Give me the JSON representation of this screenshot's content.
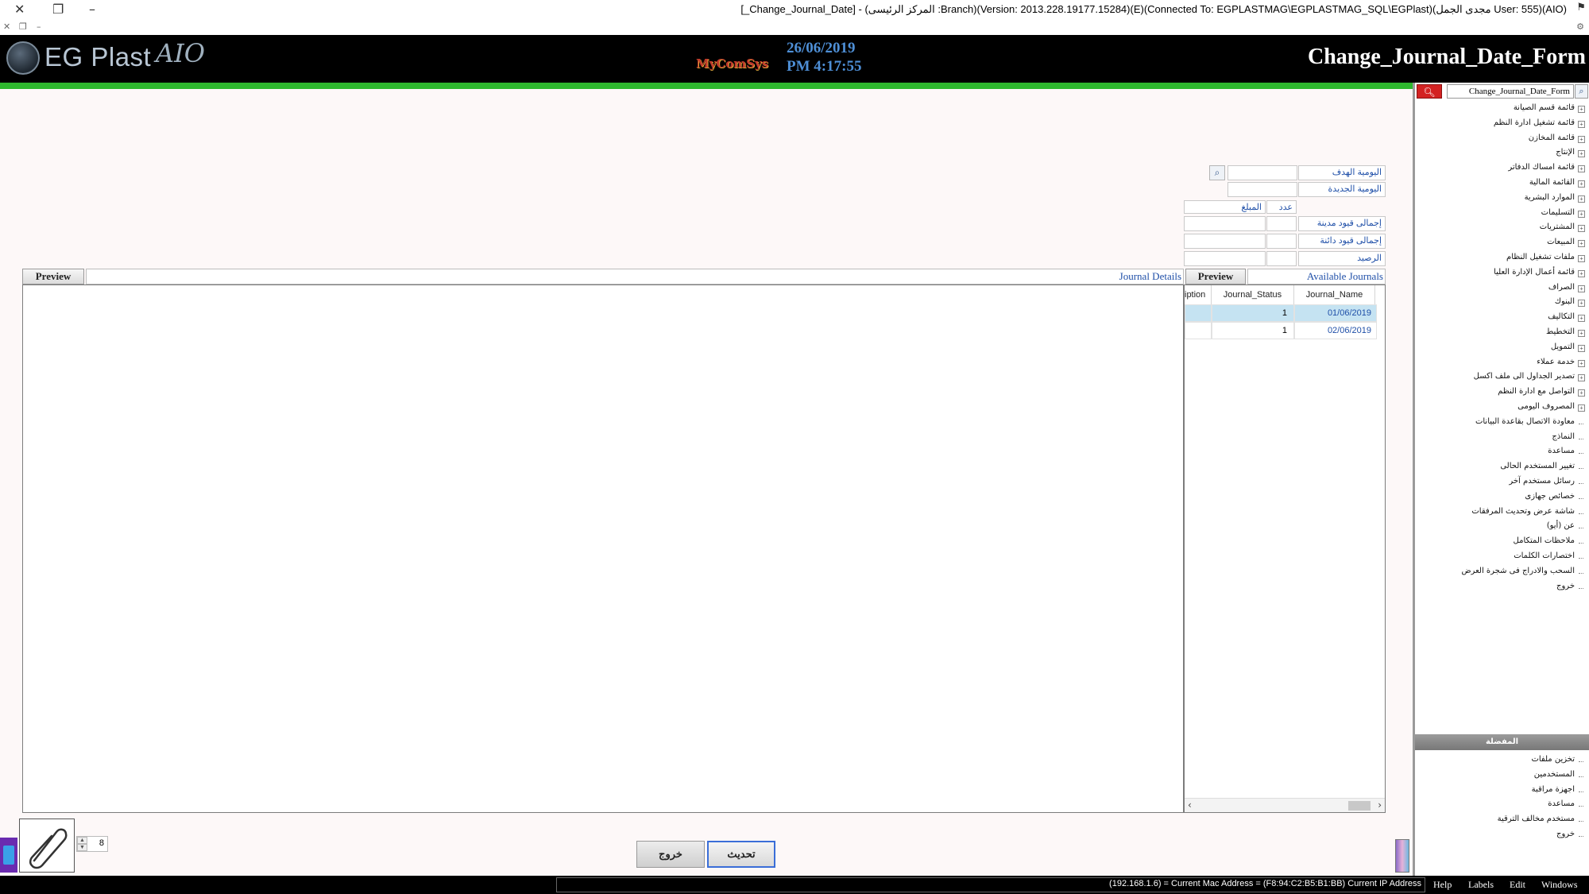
{
  "window": {
    "title": "[_Change_Journal_Date] - (المركز الرئيسى :Branch)(Version: 2013.228.19177.15284)(E)(Connected To: EGPLASTMAG\\EGPLASTMAG_SQL\\EGPlast)(مجدى الجمل User: 555)(AIO)"
  },
  "header": {
    "app_name": "EG Plast",
    "app_suffix": "AIO",
    "vendor": "MyComSys",
    "date": "26/06/2019",
    "time": "PM 4:17:55",
    "form_title": "Change_Journal_Date_Form",
    "accent_color": "#2eb82e"
  },
  "form": {
    "target_journal_label": "اليومية الهدف",
    "target_journal_value": "",
    "new_journal_label": "اليومية الجديدة",
    "new_journal_value": "",
    "count_header": "عدد",
    "amount_header": "المبلغ",
    "total_debit_label": "إجمالى قيود مدينة",
    "total_credit_label": "إجمالى قيود دائنة",
    "balance_label": "الرصيد"
  },
  "journal_details": {
    "title": "Journal Details",
    "preview_label": "Preview"
  },
  "available_journals": {
    "title": "Available Journals",
    "preview_label": "Preview",
    "columns": [
      "Journal_Name",
      "Journal_Status",
      "iption"
    ],
    "rows": [
      {
        "name": "01/06/2019",
        "status": "1",
        "selected": true
      },
      {
        "name": "02/06/2019",
        "status": "1",
        "selected": false
      }
    ]
  },
  "footer": {
    "spin_value": "8",
    "exit_label": "خروج",
    "update_label": "تحديث"
  },
  "nav": {
    "search_value": "Change_Journal_Date_Form",
    "items": [
      {
        "label": "قائمة قسم الصيانة",
        "expandable": true
      },
      {
        "label": "قائمة تشغيل ادارة النظم",
        "expandable": true
      },
      {
        "label": "قائمة المخازن",
        "expandable": true
      },
      {
        "label": "الإنتاج",
        "expandable": true
      },
      {
        "label": "قائمة امساك الدفاتر",
        "expandable": true
      },
      {
        "label": "القائمة المالية",
        "expandable": true
      },
      {
        "label": "الموارد البشرية",
        "expandable": true
      },
      {
        "label": "التسليمات",
        "expandable": true
      },
      {
        "label": "المشتريات",
        "expandable": true
      },
      {
        "label": "المبيعات",
        "expandable": true
      },
      {
        "label": "ملفات تشغيل النظام",
        "expandable": true
      },
      {
        "label": "قائمة أعمال الإدارة العليا",
        "expandable": true
      },
      {
        "label": "الصراف",
        "expandable": true
      },
      {
        "label": "البنوك",
        "expandable": true
      },
      {
        "label": "التكاليف",
        "expandable": true
      },
      {
        "label": "التخطيط",
        "expandable": true
      },
      {
        "label": "التمويل",
        "expandable": true
      },
      {
        "label": "خدمة عملاء",
        "expandable": true
      },
      {
        "label": "تصدير الجداول الى ملف اكسل",
        "expandable": true
      },
      {
        "label": "التواصل مع ادارة النظم",
        "expandable": true
      },
      {
        "label": "المصروف اليومى",
        "expandable": true
      },
      {
        "label": "معاودة الاتصال بقاعدة البيانات",
        "expandable": false
      },
      {
        "label": "النماذج",
        "expandable": false
      },
      {
        "label": "مساعدة",
        "expandable": false
      },
      {
        "label": "تغيير المستخدم الحالى",
        "expandable": false
      },
      {
        "label": "رسائل مستخدم آخر",
        "expandable": false
      },
      {
        "label": "خصائص جهازى",
        "expandable": false
      },
      {
        "label": "شاشة عرض وتحديث المرفقات",
        "expandable": false
      },
      {
        "label": "عن (أيو)",
        "expandable": false
      },
      {
        "label": "ملاحظات المتكامل",
        "expandable": false
      },
      {
        "label": "اختصارات الكلمات",
        "expandable": false
      },
      {
        "label": "السحب والادراج فى شجرة العرض",
        "expandable": false
      },
      {
        "label": "خروج",
        "expandable": false
      }
    ],
    "favorites_title": "المفضلة",
    "favorites": [
      "تخزين ملفات",
      "المستخدمين",
      "اجهزة مراقبة",
      "مساعدة",
      "مستخدم مخالف الترقية",
      "خروج"
    ]
  },
  "statusbar": {
    "text": "(192.168.1.6) = Current Mac Address = (F8:94:C2:B5:B1:BB) Current IP Address",
    "menu": [
      "Help",
      "Labels",
      "Edit",
      "Windows"
    ]
  }
}
